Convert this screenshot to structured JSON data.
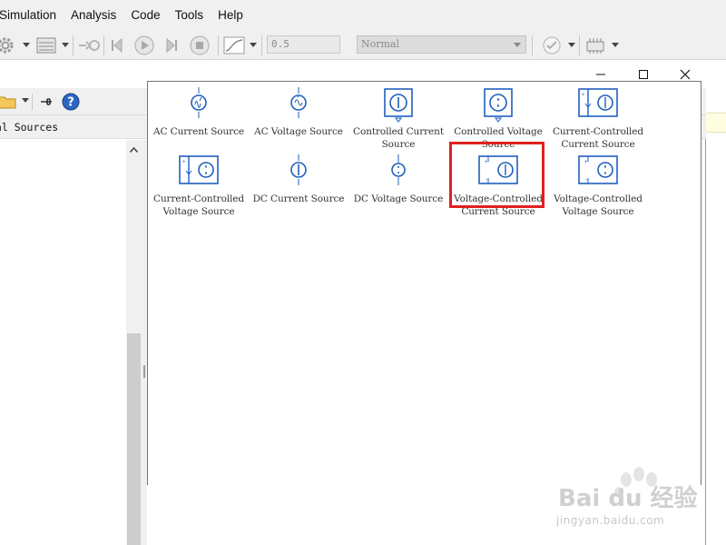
{
  "menubar": {
    "items": [
      "Simulation",
      "Analysis",
      "Code",
      "Tools",
      "Help"
    ]
  },
  "toolbar": {
    "stop_time": "0.5",
    "sim_mode": "Normal",
    "icons": [
      "settings-gear-icon",
      "library-icon",
      "step-link-icon",
      "step-back-icon",
      "run-icon",
      "step-forward-icon",
      "stop-icon",
      "scope-icon",
      "model-advisor-icon",
      "build-icon"
    ]
  },
  "library_window": {
    "breadcrumb": "cal Sources",
    "controls": [
      "minimize-icon",
      "maximize-icon",
      "close-icon"
    ],
    "toolbar_icons": [
      "folder-icon",
      "pin-icon",
      "help-icon"
    ]
  },
  "palette": {
    "blocks": [
      {
        "label": "AC Current Source",
        "icon": "ac-current-source-icon"
      },
      {
        "label": "AC Voltage Source",
        "icon": "ac-voltage-source-icon"
      },
      {
        "label": "Controlled Current Source",
        "icon": "controlled-current-source-icon"
      },
      {
        "label": "Controlled Voltage Source",
        "icon": "controlled-voltage-source-icon"
      },
      {
        "label": "Current-Controlled Current Source",
        "icon": "ccc-source-icon"
      },
      {
        "label": "Current-Controlled Voltage Source",
        "icon": "ccv-source-icon"
      },
      {
        "label": "DC Current Source",
        "icon": "dc-current-source-icon"
      },
      {
        "label": "DC Voltage Source",
        "icon": "dc-voltage-source-icon"
      },
      {
        "label": "Voltage-Controlled Current Source",
        "icon": "vcc-source-icon"
      },
      {
        "label": "Voltage-Controlled Voltage Source",
        "icon": "vcv-source-icon"
      }
    ],
    "selected_index": 3
  },
  "colors": {
    "block_blue": "#1f5fbf",
    "highlight_red": "#e02020"
  },
  "watermark": {
    "text": "Bai du 经验",
    "sub": "jingyan.baidu.com"
  }
}
